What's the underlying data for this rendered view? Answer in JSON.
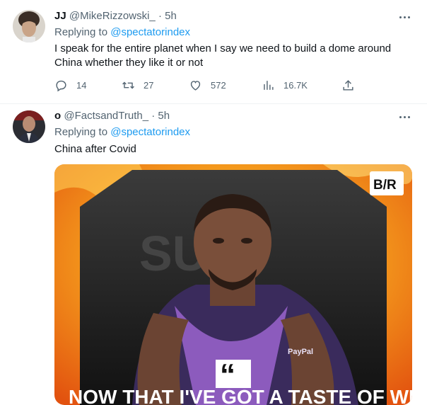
{
  "tweets": [
    {
      "display_name": "JJ",
      "handle": "@MikeRizzowski_",
      "time": "5h",
      "replying_prefix": "Replying to",
      "replying_to": "@spectatorindex",
      "text_line1": "I speak for the entire planet when I say we need to build a dome around",
      "text_line2": "China whether they like it or not",
      "reply_count": "14",
      "retweet_count": "27",
      "like_count": "572",
      "view_count": "16.7K"
    },
    {
      "display_name": "o",
      "handle": "@FactsandTruth_",
      "time": "5h",
      "replying_prefix": "Replying to",
      "replying_to": "@spectatorindex",
      "text": "China after Covid",
      "media": {
        "brand_logo": "B/R",
        "jersey_text": "PayPal",
        "caption_partial": "NOW THAT I'VE GOT A TASTE OF WHAT THAT"
      }
    }
  ],
  "colors": {
    "accent": "#1d9bf0",
    "muted": "#536471",
    "text": "#0f1419",
    "separator": "#eff3f4"
  }
}
